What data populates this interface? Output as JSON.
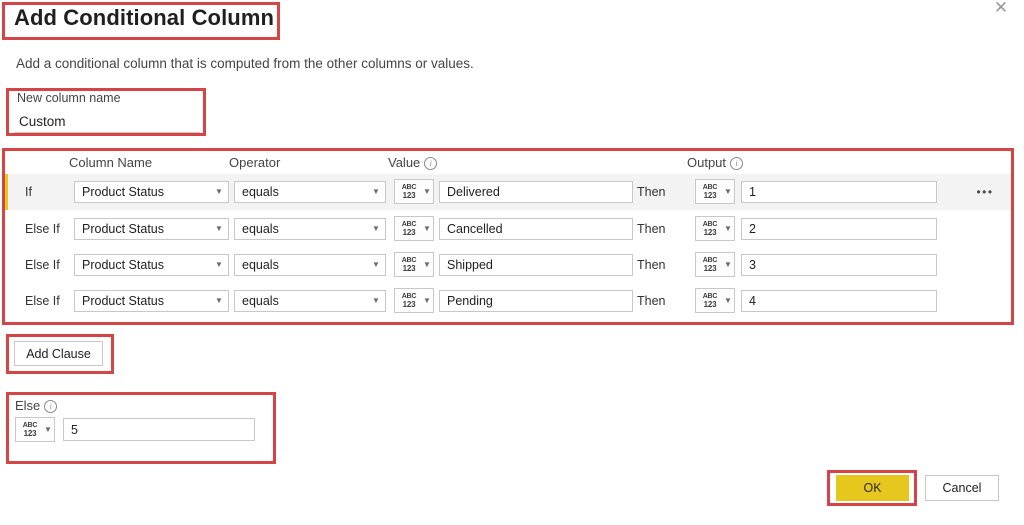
{
  "dialog": {
    "title": "Add Conditional Column",
    "subtitle": "Add a conditional column that is computed from the other columns or values.",
    "close_icon": "close-icon"
  },
  "new_column": {
    "label": "New column name",
    "value": "Custom",
    "placeholder": ""
  },
  "grid": {
    "headers": {
      "column_name": "Column Name",
      "operator": "Operator",
      "value": "Value",
      "output": "Output",
      "info_glyph": "i"
    },
    "then_label": "Then",
    "type_glyph": {
      "top": "ABC",
      "bottom": "123"
    },
    "caret_glyph": "▼",
    "more_glyph": "•••",
    "rows": [
      {
        "condition": "If",
        "column_name": "Product Status",
        "operator": "equals",
        "value": "Delivered",
        "output": "1",
        "active": true
      },
      {
        "condition": "Else If",
        "column_name": "Product Status",
        "operator": "equals",
        "value": "Cancelled",
        "output": "2",
        "active": false
      },
      {
        "condition": "Else If",
        "column_name": "Product Status",
        "operator": "equals",
        "value": "Shipped",
        "output": "3",
        "active": false
      },
      {
        "condition": "Else If",
        "column_name": "Product Status",
        "operator": "equals",
        "value": "Pending",
        "output": "4",
        "active": false
      }
    ]
  },
  "add_clause": {
    "label": "Add Clause"
  },
  "else_block": {
    "label": "Else",
    "value": "5"
  },
  "footer": {
    "ok_label": "OK",
    "cancel_label": "Cancel"
  },
  "colors": {
    "accent": "#e5c71e",
    "annotation": "#d64545",
    "row_highlight": "#f3f3f3"
  }
}
